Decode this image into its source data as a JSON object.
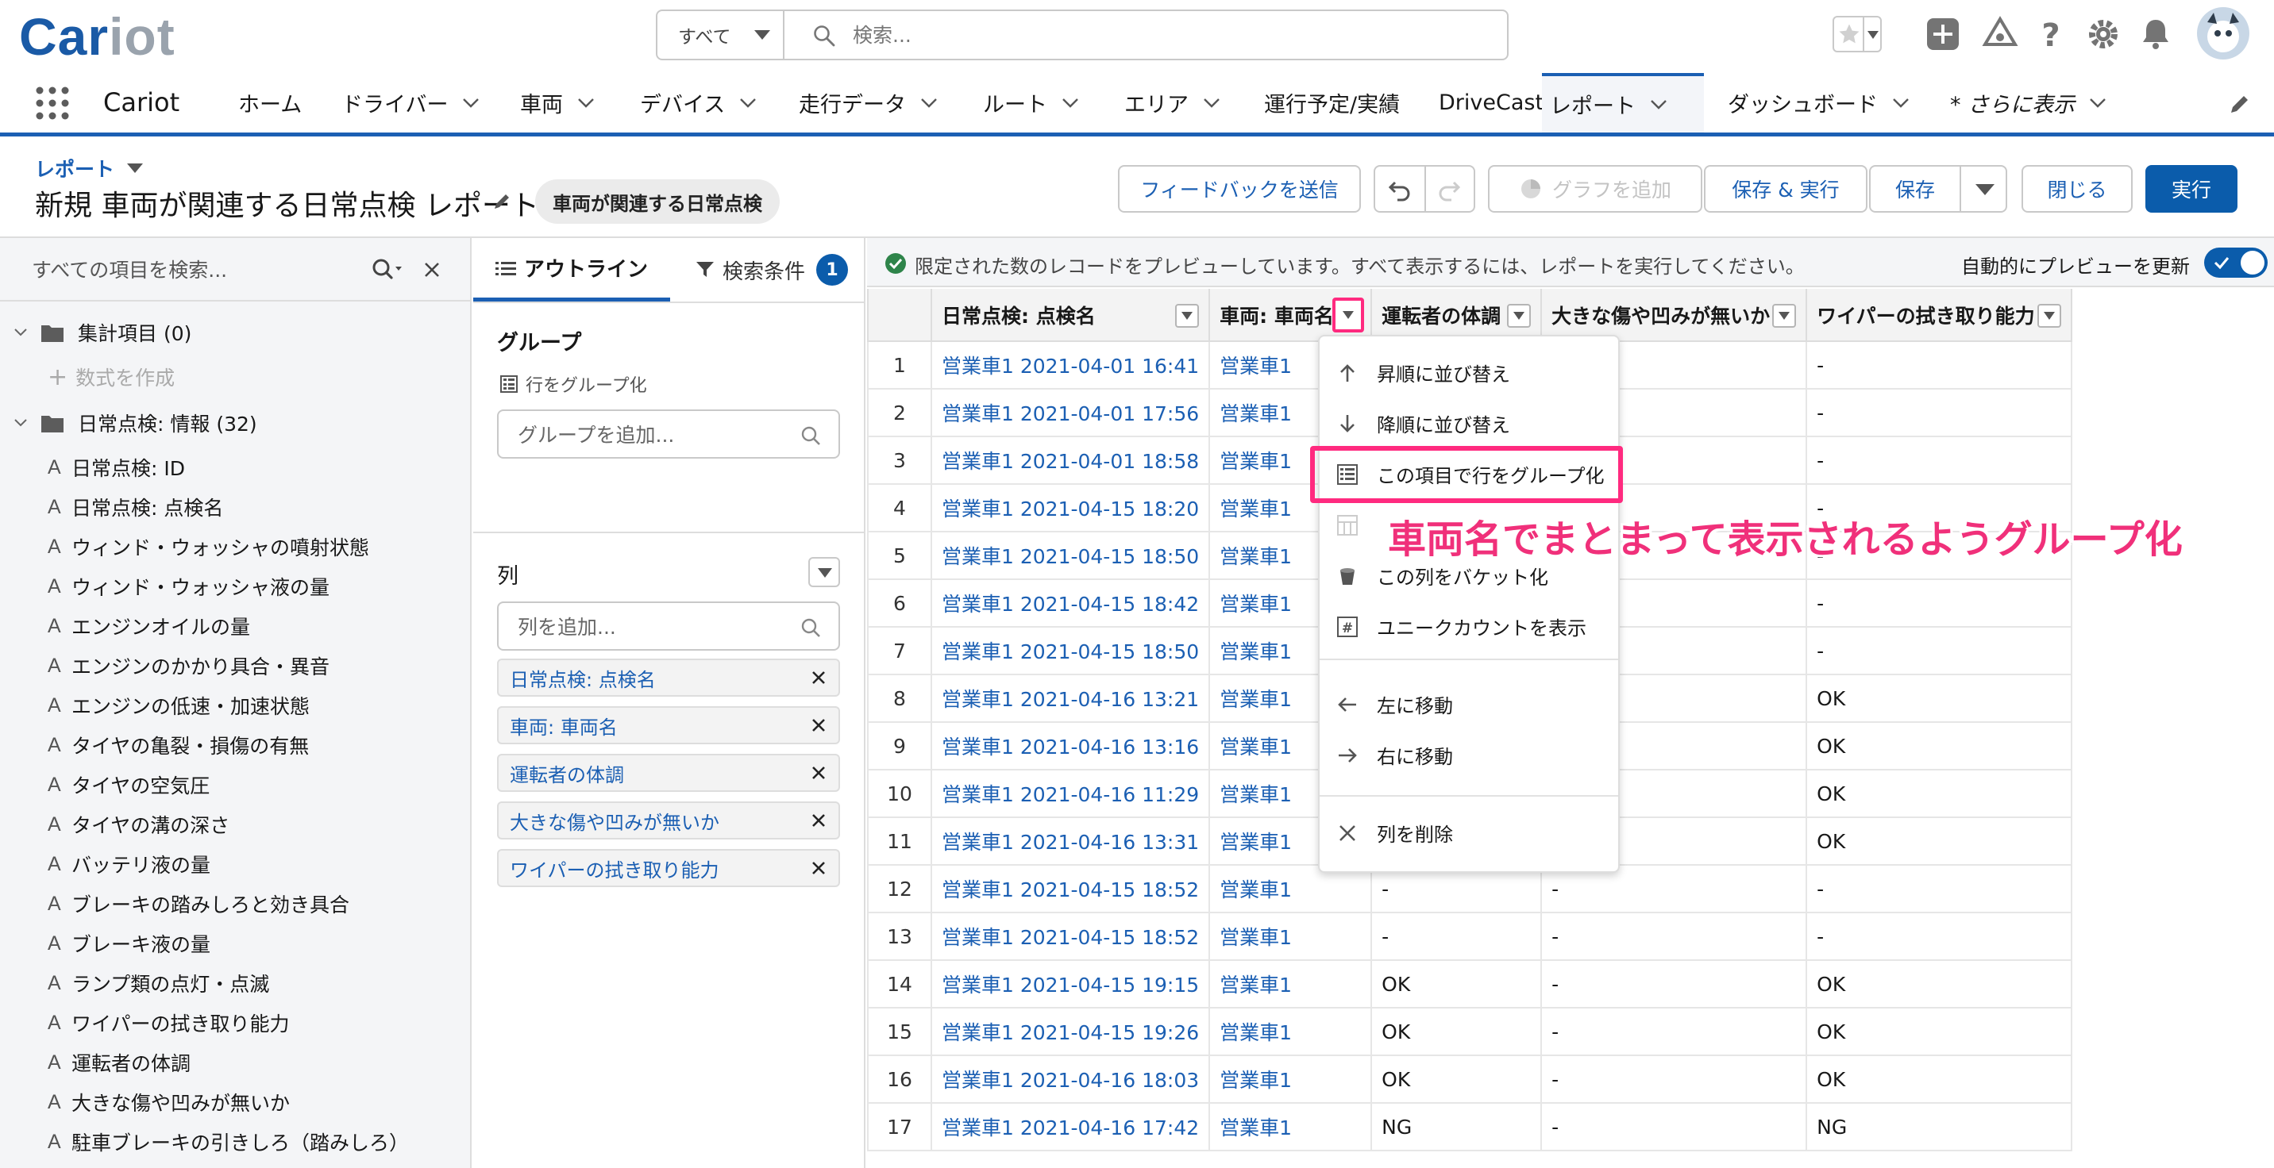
{
  "header": {
    "logo_main": "Car",
    "logo_accent": "iot",
    "search_scope": "すべて",
    "search_placeholder": "検索..."
  },
  "nav": {
    "app_name": "Cariot",
    "items": [
      {
        "label": "ホーム",
        "chevron": false
      },
      {
        "label": "ドライバー",
        "chevron": true
      },
      {
        "label": "車両",
        "chevron": true
      },
      {
        "label": "デバイス",
        "chevron": true
      },
      {
        "label": "走行データ",
        "chevron": true
      },
      {
        "label": "ルート",
        "chevron": true
      },
      {
        "label": "エリア",
        "chevron": true
      },
      {
        "label": "運行予定/実績",
        "chevron": false
      },
      {
        "label": "DriveCast",
        "chevron": false
      },
      {
        "label": "レポート",
        "chevron": true,
        "active": true
      },
      {
        "label": "ダッシュボード",
        "chevron": true
      },
      {
        "label": "* さらに表示",
        "chevron": true
      }
    ]
  },
  "page": {
    "breadcrumb": "レポート",
    "title": "新規 車両が関連する日常点検 レポート",
    "report_type": "車両が関連する日常点検",
    "buttons": {
      "feedback": "フィードバックを送信",
      "add_chart": "グラフを追加",
      "save_run": "保存 & 実行",
      "save": "保存",
      "close": "閉じる",
      "run": "実行"
    }
  },
  "fields_panel": {
    "search_placeholder": "すべての項目を検索...",
    "summary_folder": "集計項目 (0)",
    "create_formula": "数式を作成",
    "info_folder": "日常点検: 情報 (32)",
    "fields": [
      "日常点検: ID",
      "日常点検: 点検名",
      "ウィンド・ウォッシャの噴射状態",
      "ウィンド・ウォッシャ液の量",
      "エンジンオイルの量",
      "エンジンのかかり具合・異音",
      "エンジンの低速・加速状態",
      "タイヤの亀裂・損傷の有無",
      "タイヤの空気圧",
      "タイヤの溝の深さ",
      "バッテリ液の量",
      "ブレーキの踏みしろと効き具合",
      "ブレーキ液の量",
      "ランプ類の点灯・点滅",
      "ワイパーの拭き取り能力",
      "運転者の体調",
      "大きな傷や凹みが無いか",
      "駐車ブレーキの引きしろ（踏みしろ）"
    ]
  },
  "outline": {
    "tab_outline": "アウトライン",
    "tab_filters": "検索条件",
    "filter_count": "1",
    "group_heading": "グループ",
    "group_rows_label": "行をグループ化",
    "group_placeholder": "グループを追加...",
    "columns_heading": "列",
    "columns_placeholder": "列を追加...",
    "columns": [
      "日常点検: 点検名",
      "車両: 車両名",
      "運転者の体調",
      "大きな傷や凹みが無いか",
      "ワイパーの拭き取り能力"
    ]
  },
  "preview": {
    "message": "限定された数のレコードをプレビューしています。すべて表示するには、レポートを実行してください。",
    "auto_update_label": "自動的にプレビューを更新",
    "columns": [
      "日常点検: 点検名",
      "車両: 車両名",
      "運転者の体調",
      "大きな傷や凹みが無いか",
      "ワイパーの拭き取り能力"
    ],
    "rows": [
      [
        "1",
        "営業車1 2021-04-01 16:41",
        "営業車1",
        "",
        "",
        "-"
      ],
      [
        "2",
        "営業車1 2021-04-01 17:56",
        "営業車1",
        "",
        "",
        "-"
      ],
      [
        "3",
        "営業車1 2021-04-01 18:58",
        "営業車1",
        "",
        "",
        "-"
      ],
      [
        "4",
        "営業車1 2021-04-15 18:20",
        "営業車1",
        "",
        "",
        "-"
      ],
      [
        "5",
        "営業車1 2021-04-15 18:50",
        "営業車1",
        "",
        "",
        "-"
      ],
      [
        "6",
        "営業車1 2021-04-15 18:42",
        "営業車1",
        "",
        "",
        "-"
      ],
      [
        "7",
        "営業車1 2021-04-15 18:50",
        "営業車1",
        "",
        "",
        "-"
      ],
      [
        "8",
        "営業車1 2021-04-16 13:21",
        "営業車1",
        "",
        "",
        "OK"
      ],
      [
        "9",
        "営業車1 2021-04-16 13:16",
        "営業車1",
        "",
        "",
        "OK"
      ],
      [
        "10",
        "営業車1 2021-04-16 11:29",
        "営業車1",
        "",
        "",
        "OK"
      ],
      [
        "11",
        "営業車1 2021-04-16 13:31",
        "営業車1",
        "",
        "",
        "OK"
      ],
      [
        "12",
        "営業車1 2021-04-15 18:52",
        "営業車1",
        "-",
        "-",
        "-"
      ],
      [
        "13",
        "営業車1 2021-04-15 18:52",
        "営業車1",
        "-",
        "-",
        "-"
      ],
      [
        "14",
        "営業車1 2021-04-15 19:15",
        "営業車1",
        "OK",
        "-",
        "OK"
      ],
      [
        "15",
        "営業車1 2021-04-15 19:26",
        "営業車1",
        "OK",
        "-",
        "OK"
      ],
      [
        "16",
        "営業車1 2021-04-16 18:03",
        "営業車1",
        "OK",
        "-",
        "OK"
      ],
      [
        "17",
        "営業車1 2021-04-16 17:42",
        "営業車1",
        "NG",
        "-",
        "NG"
      ]
    ]
  },
  "column_menu": {
    "items": [
      {
        "label": "昇順に並び替え",
        "icon": "arrow-up-icon"
      },
      {
        "label": "降順に並び替え",
        "icon": "arrow-down-icon"
      },
      {
        "label": "この項目で行をグループ化",
        "icon": "group-rows-icon"
      },
      {
        "label": "",
        "icon": "group-columns-icon"
      },
      {
        "label": "この列をバケット化",
        "icon": "bucket-icon"
      },
      {
        "label": "ユニークカウントを表示",
        "icon": "hash-icon"
      },
      {
        "label": "左に移動",
        "icon": "arrow-left-icon"
      },
      {
        "label": "右に移動",
        "icon": "arrow-right-icon"
      },
      {
        "label": "列を削除",
        "icon": "close-icon"
      }
    ]
  },
  "annotation": {
    "text": "車両名でまとまって表示されるようグループ化",
    "color": "#f0307a"
  },
  "colors": {
    "brand": "#1b5fb3",
    "primary_button": "#0b5cab",
    "highlight": "#ff2a7f"
  }
}
